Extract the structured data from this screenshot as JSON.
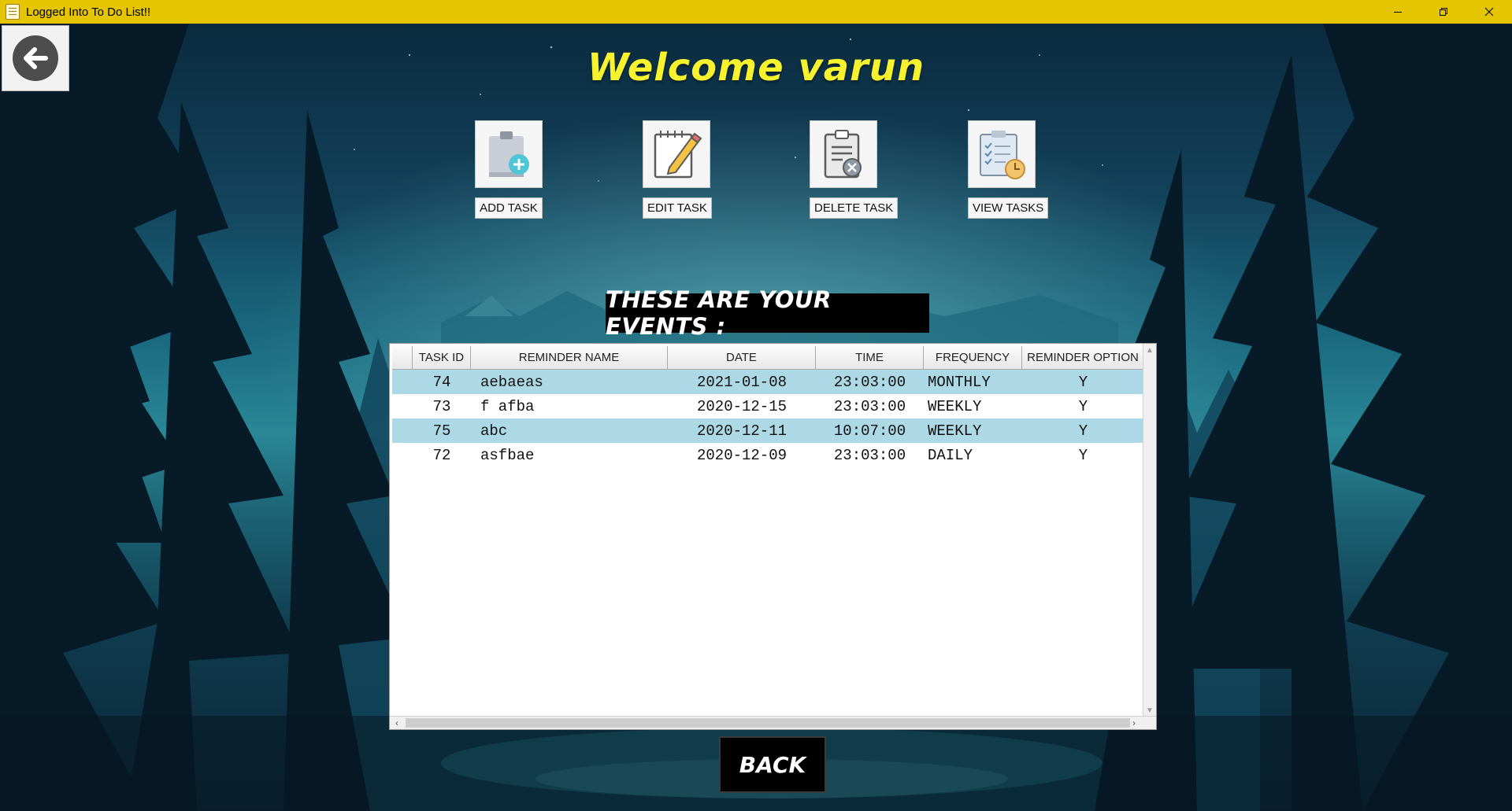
{
  "window": {
    "title": "Logged Into To Do List!!",
    "controls": [
      "minimize",
      "restore",
      "close"
    ]
  },
  "header": {
    "back_icon": "arrow-left-circle-icon",
    "welcome": "Welcome varun"
  },
  "actions": [
    {
      "label": "ADD TASK",
      "icon": "clipboard-add-icon"
    },
    {
      "label": "EDIT TASK",
      "icon": "notepad-pencil-icon"
    },
    {
      "label": "DELETE TASK",
      "icon": "clipboard-delete-icon"
    },
    {
      "label": "VIEW TASKS",
      "icon": "checklist-clock-icon"
    }
  ],
  "events": {
    "title": "THESE ARE YOUR EVENTS :",
    "columns": [
      "TASK ID",
      "REMINDER NAME",
      "DATE",
      "TIME",
      "FREQUENCY",
      "REMINDER OPTION"
    ],
    "rows": [
      {
        "id": "74",
        "name": "aebaeas",
        "date": "2021-01-08",
        "time": "23:03:00",
        "frequency": "MONTHLY",
        "option": "Y",
        "selected": true
      },
      {
        "id": "73",
        "name": "f afba",
        "date": "2020-12-15",
        "time": "23:03:00",
        "frequency": "WEEKLY",
        "option": "Y",
        "selected": false
      },
      {
        "id": "75",
        "name": "abc",
        "date": "2020-12-11",
        "time": "10:07:00",
        "frequency": "WEEKLY",
        "option": "Y",
        "selected": true
      },
      {
        "id": "72",
        "name": "asfbae",
        "date": "2020-12-09",
        "time": "23:03:00",
        "frequency": "DAILY",
        "option": "Y",
        "selected": false
      }
    ]
  },
  "footer": {
    "back_label": "BACK"
  },
  "colors": {
    "titlebar": "#e5c400",
    "welcome_text": "#f7f22e",
    "row_selected": "#add8e6"
  }
}
